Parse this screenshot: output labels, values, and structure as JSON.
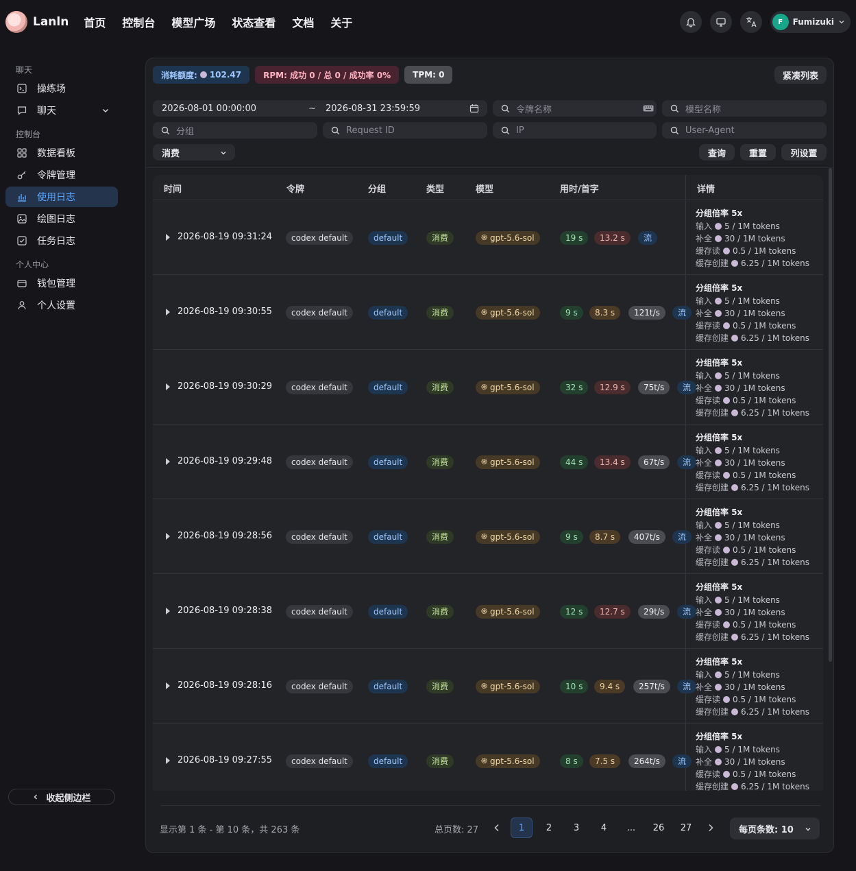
{
  "brand": {
    "name": "Lanln"
  },
  "nav": [
    "首页",
    "控制台",
    "模型广场",
    "状态查看",
    "文档",
    "关于"
  ],
  "user": {
    "initial": "F",
    "name": "Fumizuki"
  },
  "sidebar": {
    "sections": [
      {
        "title": "聊天",
        "items": [
          {
            "label": "操练场",
            "icon": "playground-icon"
          },
          {
            "label": "聊天",
            "icon": "chat-icon",
            "expandable": true
          }
        ]
      },
      {
        "title": "控制台",
        "items": [
          {
            "label": "数据看板",
            "icon": "dashboard-icon"
          },
          {
            "label": "令牌管理",
            "icon": "key-icon"
          },
          {
            "label": "使用日志",
            "icon": "bar-chart-icon",
            "active": true
          },
          {
            "label": "绘图日志",
            "icon": "image-icon"
          },
          {
            "label": "任务日志",
            "icon": "task-icon"
          }
        ]
      },
      {
        "title": "个人中心",
        "items": [
          {
            "label": "钱包管理",
            "icon": "wallet-icon"
          },
          {
            "label": "个人设置",
            "icon": "user-icon"
          }
        ]
      }
    ],
    "collapse_label": "收起侧边栏"
  },
  "stats": {
    "quota_label": "消耗额度:",
    "quota_value": "102.47",
    "rpm": "RPM: 成功 0 / 总 0 / 成功率 0%",
    "tpm": "TPM: 0",
    "compact_label": "紧凑列表"
  },
  "filters": {
    "date_start": "2026-08-01 00:00:00",
    "date_sep": "~",
    "date_end": "2026-08-31 23:59:59",
    "token_placeholder": "令牌名称",
    "model_placeholder": "模型名称",
    "group_placeholder": "分组",
    "request_placeholder": "Request ID",
    "ip_placeholder": "IP",
    "ua_placeholder": "User-Agent",
    "type_value": "消费",
    "query_label": "查询",
    "reset_label": "重置",
    "columns_label": "列设置"
  },
  "table": {
    "headers": [
      "时间",
      "令牌",
      "分组",
      "类型",
      "模型",
      "用时/首字",
      "详情"
    ],
    "detail": {
      "title": "分组倍率 5x",
      "lines": [
        {
          "k": "输入",
          "v": "5 / 1M tokens"
        },
        {
          "k": "补全",
          "v": "30 / 1M tokens"
        },
        {
          "k": "缓存读",
          "v": "0.5 / 1M tokens"
        },
        {
          "k": "缓存创建",
          "v": "6.25 / 1M tokens"
        }
      ]
    },
    "rows": [
      {
        "time": "2026-08-19 09:31:24",
        "token": "codex default",
        "group": "default",
        "type": "消费",
        "model": "gpt-5.6-sol",
        "duration": "19 s",
        "first": "13.2 s",
        "first_tone": "red",
        "speed": "",
        "stream": "流"
      },
      {
        "time": "2026-08-19 09:30:55",
        "token": "codex default",
        "group": "default",
        "type": "消费",
        "model": "gpt-5.6-sol",
        "duration": "9 s",
        "first": "8.3 s",
        "first_tone": "yellow",
        "speed": "121t/s",
        "stream": "流"
      },
      {
        "time": "2026-08-19 09:30:29",
        "token": "codex default",
        "group": "default",
        "type": "消费",
        "model": "gpt-5.6-sol",
        "duration": "32 s",
        "first": "12.9 s",
        "first_tone": "red",
        "speed": "75t/s",
        "stream": "流"
      },
      {
        "time": "2026-08-19 09:29:48",
        "token": "codex default",
        "group": "default",
        "type": "消费",
        "model": "gpt-5.6-sol",
        "duration": "44 s",
        "first": "13.4 s",
        "first_tone": "red",
        "speed": "67t/s",
        "stream": "流"
      },
      {
        "time": "2026-08-19 09:28:56",
        "token": "codex default",
        "group": "default",
        "type": "消费",
        "model": "gpt-5.6-sol",
        "duration": "9 s",
        "first": "8.7 s",
        "first_tone": "yellow",
        "speed": "407t/s",
        "stream": "流"
      },
      {
        "time": "2026-08-19 09:28:38",
        "token": "codex default",
        "group": "default",
        "type": "消费",
        "model": "gpt-5.6-sol",
        "duration": "12 s",
        "first": "12.7 s",
        "first_tone": "red",
        "speed": "29t/s",
        "stream": "流"
      },
      {
        "time": "2026-08-19 09:28:16",
        "token": "codex default",
        "group": "default",
        "type": "消费",
        "model": "gpt-5.6-sol",
        "duration": "10 s",
        "first": "9.4 s",
        "first_tone": "yellow",
        "speed": "257t/s",
        "stream": "流"
      },
      {
        "time": "2026-08-19 09:27:55",
        "token": "codex default",
        "group": "default",
        "type": "消费",
        "model": "gpt-5.6-sol",
        "duration": "8 s",
        "first": "7.5 s",
        "first_tone": "yellow",
        "speed": "264t/s",
        "stream": "流"
      }
    ]
  },
  "footer": {
    "info": "显示第 1 条 - 第 10 条，共 263 条",
    "total_pages": "总页数:  27",
    "pages": [
      "1",
      "2",
      "3",
      "4",
      "...",
      "26",
      "27"
    ],
    "current_page": "1",
    "per_page": "每页条数:  10"
  }
}
